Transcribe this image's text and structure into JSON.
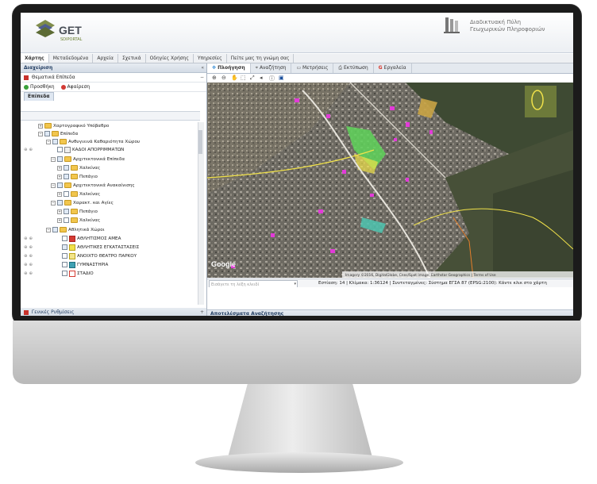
{
  "header": {
    "logo_text": "GET",
    "logo_sub": "SDIPORTAL",
    "gov_line1": "Διαδικτυακή Πύλη",
    "gov_line2": "Γεωχωρικών Πληροφοριών"
  },
  "menu": [
    {
      "label": "Χάρτης",
      "active": true
    },
    {
      "label": "Μεταδεδομένα",
      "active": false
    },
    {
      "label": "Αρχεία",
      "active": false
    },
    {
      "label": "Σχετικά",
      "active": false
    },
    {
      "label": "Οδηγίες Χρήσης",
      "active": false
    },
    {
      "label": "Υπηρεσίες",
      "active": false
    },
    {
      "label": "Πείτε μας τη γνώμη σας",
      "active": false
    }
  ],
  "left_panel": {
    "title": "Διαχείριση",
    "section_title": "Θεματικά Επίπεδα",
    "add_label": "Προσθήκη",
    "remove_label": "Αφαίρεση",
    "tab_label": "Επίπεδα",
    "footer_label": "Γενικές Ρυθμίσεις",
    "tree": [
      {
        "label": "Χαρτογραφικό Υπόβαθρο",
        "indent": 0,
        "checked": false,
        "type": "folder"
      },
      {
        "label": "Επίπεδα",
        "indent": 0,
        "checked": true,
        "type": "folder"
      },
      {
        "label": "Ανθυγιεινά Καθαριότητα Χώρου",
        "indent": 1,
        "checked": true,
        "type": "folder"
      },
      {
        "label": "ΚΑΔΟΙ ΑΠΟΡΡΙΜΜΑΤΩΝ",
        "indent": 2,
        "checked": false,
        "type": "layer"
      },
      {
        "label": "Αρχιτεκτονικά Επίπεδα",
        "indent": 1,
        "checked": true,
        "type": "folder"
      },
      {
        "label": "Χαλκίνας",
        "indent": 2,
        "checked": true,
        "type": "folder"
      },
      {
        "label": "Πεπάγιο",
        "indent": 2,
        "checked": true,
        "type": "folder"
      },
      {
        "label": "Αρχιτεκτονικά Ανακαίνισης",
        "indent": 1,
        "checked": true,
        "type": "folder"
      },
      {
        "label": "Χαλκίνας",
        "indent": 2,
        "checked": false,
        "type": "folder"
      },
      {
        "label": "Χαρακτ. και Αγίες",
        "indent": 1,
        "checked": true,
        "type": "folder"
      },
      {
        "label": "Πεπάγιο",
        "indent": 2,
        "checked": true,
        "type": "folder"
      },
      {
        "label": "Χαλκίνας",
        "indent": 2,
        "checked": false,
        "type": "folder"
      },
      {
        "label": "Αθλητικά Χώροι",
        "indent": 0,
        "checked": true,
        "type": "folder"
      },
      {
        "label": "ΑΘΛΗΤΙΣΜΟΣ ΑΜΕΑ",
        "indent": 1,
        "checked": false,
        "type": "layer-red"
      },
      {
        "label": "ΑΘΛΗΤΙΚΕΣ ΕΓΚΑΤΑΣΤΑΣΕΙΣ",
        "indent": 1,
        "checked": true,
        "type": "layer-yellow"
      },
      {
        "label": "ΑΝΟΙΧΤΟ ΘΕΑΤΡΟ ΠΑΡΚΟΥ",
        "indent": 1,
        "checked": false,
        "type": "layer-yellow"
      },
      {
        "label": "ΓΥΜΝΑΣΤΗΡΙΑ",
        "indent": 1,
        "checked": false,
        "type": "layer-teal"
      },
      {
        "label": "ΣΤΑΔΙΟ",
        "indent": 1,
        "checked": false,
        "type": "layer-red"
      }
    ]
  },
  "map_panel": {
    "tabs": [
      {
        "label": "Πλοήγηση",
        "active": true
      },
      {
        "label": "Αναζήτηση",
        "active": false
      },
      {
        "label": "Μετρήσεις",
        "active": false
      },
      {
        "label": "Εκτύπωση",
        "active": false
      },
      {
        "label": "Εργαλεία",
        "active": false
      }
    ],
    "google_label": "Google",
    "attribution": "Imagery ©2016, DigitalGlobe, Cnes/Spot Image, Earthstar Geographics | Terms of Use",
    "search_placeholder": "Εισάγετε τη λέξη κλειδί",
    "scale_text": "Εστίαση: 14 | Κλίμακα: 1:36124 | Συντεταγμένες: Σύστημα ΕΓΣΑ 87 (EPSG:2100): Κάντε κλικ στο χάρτη",
    "results_label": "Αποτελέσματα Αναζήτησης"
  },
  "colors": {
    "panel_header": "#1e3a5f",
    "accent_green": "#6a7f2e",
    "map_overlay_magenta": "#e23bd8",
    "map_overlay_green": "#5fd35a",
    "map_overlay_yellow": "#f1e24a"
  }
}
